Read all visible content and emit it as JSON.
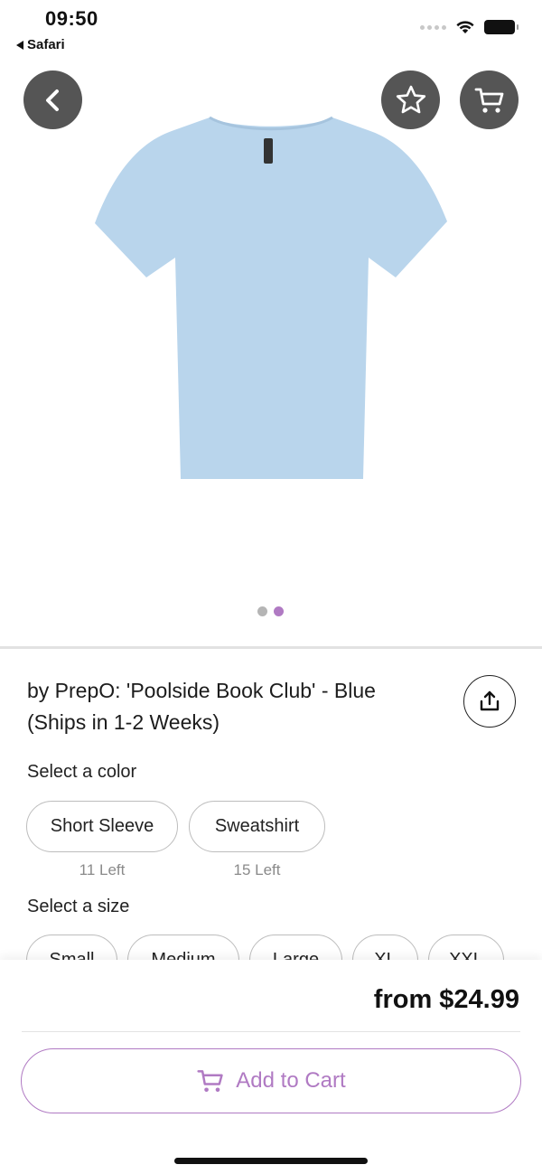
{
  "status_bar": {
    "time": "09:50",
    "back_app": "Safari",
    "wifi_icon": "wifi-icon",
    "battery_icon": "battery-icon"
  },
  "header": {
    "back_icon": "chevron-left-icon",
    "favorite_icon": "star-icon",
    "cart_icon": "cart-icon",
    "button_color": "#555555"
  },
  "product": {
    "image_icon": "tshirt-image",
    "image_color": "#b9d5ec",
    "title": "by PrepO: 'Poolside Book Club' - Blue (Ships in 1-2 Weeks)",
    "share_icon": "share-icon",
    "carousel": {
      "pages": 2,
      "active_index": 1,
      "active_color": "#b07ac3",
      "inactive_color": "#b5b5b5"
    }
  },
  "color_section": {
    "label": "Select a color",
    "options": [
      {
        "label": "Short Sleeve",
        "stock": "11 Left"
      },
      {
        "label": "Sweatshirt",
        "stock": "15 Left"
      }
    ]
  },
  "size_section": {
    "label": "Select a size",
    "options": [
      "Small",
      "Medium",
      "Large",
      "XL",
      "XXL"
    ]
  },
  "footer": {
    "price": "from $24.99",
    "add_to_cart_label": "Add to Cart",
    "accent_color": "#b07ac3"
  }
}
